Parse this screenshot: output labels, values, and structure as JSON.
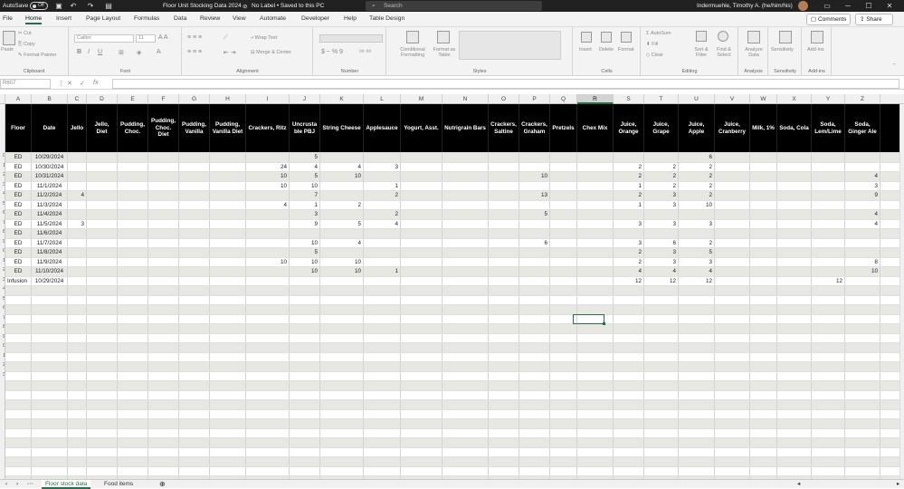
{
  "titlebar": {
    "autosave": "AutoSave",
    "toggle": "Off",
    "filename": "Floor Unit Stocking Data 2024",
    "label_status": "No Label • Saved to this PC",
    "search": "Search",
    "user": "Indermuehle, Timothy A. (he/him/his)",
    "icons": [
      "save-icon",
      "undo-icon",
      "redo-icon",
      "customize-icon"
    ]
  },
  "tabs": [
    "File",
    "Home",
    "Insert",
    "Page Layout",
    "Formulas",
    "Data",
    "Review",
    "View",
    "Automate",
    "Developer",
    "Help",
    "Table Design"
  ],
  "active_tab": "Home",
  "header_buttons": {
    "comments": "Comments",
    "share": "Share"
  },
  "ribbon": {
    "clipboard": {
      "paste": "Paste",
      "cut": "Cut",
      "copy": "Copy",
      "format_painter": "Format Painter",
      "label": "Clipboard"
    },
    "font": {
      "name": "Calibri",
      "size": "11",
      "label": "Font"
    },
    "alignment": {
      "wrap": "Wrap Text",
      "merge": "Merge & Center",
      "label": "Alignment"
    },
    "number": {
      "label": "Number"
    },
    "styles": {
      "conditional": "Conditional Formatting",
      "format_table": "Format as Table",
      "label": "Styles"
    },
    "cells": {
      "insert": "Insert",
      "delete": "Delete",
      "format": "Format",
      "label": "Cells"
    },
    "editing": {
      "autosum": "AutoSum",
      "fill": "Fill",
      "clear": "Clear",
      "sort": "Sort & Filter",
      "find": "Find & Select",
      "label": "Editing"
    },
    "analysis": {
      "analyze": "Analyze Data",
      "label": "Analysis"
    },
    "sensitivity": {
      "btn": "Sensitivity",
      "label": "Sensitivity"
    },
    "addins": {
      "btn": "Add-ins",
      "label": "Add-ins"
    }
  },
  "formula_bar": {
    "name_box": "R607",
    "fx": "fx"
  },
  "columns": [
    "A",
    "B",
    "C",
    "D",
    "E",
    "F",
    "G",
    "H",
    "I",
    "J",
    "K",
    "L",
    "M",
    "N",
    "O",
    "P",
    "Q",
    "R",
    "S",
    "T",
    "U",
    "V",
    "W",
    "X",
    "Y",
    "Z"
  ],
  "selected_column": "R",
  "row_numbers": [
    "0",
    "1",
    "2",
    "3",
    "4",
    "5",
    "6",
    "7",
    "8",
    "9",
    "0",
    "1",
    "2",
    "3",
    "4",
    "5",
    "6",
    "7",
    "8",
    "9",
    "0",
    "1",
    "2",
    "3"
  ],
  "table": {
    "headers": [
      "Floor",
      "Date",
      "Jello",
      "Jello, Diet",
      "Pudding, Choc.",
      "Pudding, Choc. Diet",
      "Pudding, Vanilla",
      "Pudding, Vanilla Diet",
      "Crackers, Ritz",
      "Uncrusta ble PBJ",
      "String Cheese",
      "Applesauce",
      "Yogurt, Asst.",
      "Nutrigrain Bars",
      "Crackers, Saltine",
      "Crackers, Graham",
      "Pretzels",
      "Chex Mix",
      "Juice, Orange",
      "Juice, Grape",
      "Juice, Apple",
      "Juice, Cranberry",
      "Milk, 1%",
      "Soda, Cola",
      "Soda, Lem/Lime",
      "Soda, Ginger Ale"
    ],
    "rows": [
      [
        "ED",
        "10/29/2024",
        "",
        "",
        "",
        "",
        "",
        "",
        "",
        "5",
        "",
        "",
        "",
        "",
        "",
        "",
        "",
        "",
        "",
        "",
        "6",
        "",
        "",
        "",
        "",
        ""
      ],
      [
        "ED",
        "10/30/2024",
        "",
        "",
        "",
        "",
        "",
        "",
        "24",
        "4",
        "4",
        "3",
        "",
        "",
        "",
        "",
        "",
        "",
        "2",
        "2",
        "2",
        "",
        "",
        "",
        "",
        ""
      ],
      [
        "ED",
        "10/31/2024",
        "",
        "",
        "",
        "",
        "",
        "",
        "10",
        "5",
        "10",
        "",
        "",
        "",
        "",
        "10",
        "",
        "",
        "2",
        "2",
        "2",
        "",
        "",
        "",
        "",
        "4"
      ],
      [
        "ED",
        "11/1/2024",
        "",
        "",
        "",
        "",
        "",
        "",
        "10",
        "10",
        "",
        "1",
        "",
        "",
        "",
        "",
        "",
        "",
        "1",
        "2",
        "2",
        "",
        "",
        "",
        "",
        "3"
      ],
      [
        "ED",
        "11/2/2024",
        "4",
        "",
        "",
        "",
        "",
        "",
        "",
        "7",
        "",
        "2",
        "",
        "",
        "",
        "13",
        "",
        "",
        "2",
        "3",
        "2",
        "",
        "",
        "",
        "",
        "9"
      ],
      [
        "ED",
        "11/3/2024",
        "",
        "",
        "",
        "",
        "",
        "",
        "4",
        "1",
        "2",
        "",
        "",
        "",
        "",
        "",
        "",
        "",
        "1",
        "3",
        "10",
        "",
        "",
        "",
        "",
        ""
      ],
      [
        "ED",
        "11/4/2024",
        "",
        "",
        "",
        "",
        "",
        "",
        "",
        "3",
        "",
        "2",
        "",
        "",
        "",
        "5",
        "",
        "",
        "",
        "",
        "",
        "",
        "",
        "",
        "",
        "4"
      ],
      [
        "ED",
        "11/5/2024",
        "3",
        "",
        "",
        "",
        "",
        "",
        "",
        "9",
        "5",
        "4",
        "",
        "",
        "",
        "",
        "",
        "",
        "3",
        "3",
        "3",
        "",
        "",
        "",
        "",
        "4"
      ],
      [
        "ED",
        "11/6/2024",
        "",
        "",
        "",
        "",
        "",
        "",
        "",
        "",
        "",
        "",
        "",
        "",
        "",
        "",
        "",
        "",
        "",
        "",
        "",
        "",
        "",
        "",
        "",
        ""
      ],
      [
        "ED",
        "11/7/2024",
        "",
        "",
        "",
        "",
        "",
        "",
        "",
        "10",
        "4",
        "",
        "",
        "",
        "",
        "6",
        "",
        "",
        "3",
        "6",
        "2",
        "",
        "",
        "",
        "",
        ""
      ],
      [
        "ED",
        "11/8/2024",
        "",
        "",
        "",
        "",
        "",
        "",
        "",
        "5",
        "",
        "",
        "",
        "",
        "",
        "",
        "",
        "",
        "2",
        "3",
        "5",
        "",
        "",
        "",
        "",
        ""
      ],
      [
        "ED",
        "11/9/2024",
        "",
        "",
        "",
        "",
        "",
        "",
        "10",
        "10",
        "10",
        "",
        "",
        "",
        "",
        "",
        "",
        "",
        "2",
        "3",
        "3",
        "",
        "",
        "",
        "",
        "8"
      ],
      [
        "ED",
        "11/10/2024",
        "",
        "",
        "",
        "",
        "",
        "",
        "",
        "10",
        "10",
        "1",
        "",
        "",
        "",
        "",
        "",
        "",
        "4",
        "4",
        "4",
        "",
        "",
        "",
        "",
        "10"
      ],
      [
        "Infusion",
        "10/29/2024",
        "",
        "",
        "",
        "",
        "",
        "",
        "",
        "",
        "",
        "",
        "",
        "",
        "",
        "",
        "",
        "",
        "12",
        "12",
        "12",
        "",
        "",
        "",
        "12",
        ""
      ]
    ]
  },
  "sheets": [
    "Floor stock data",
    "Food items"
  ],
  "active_sheet": "Floor stock data",
  "colors": {
    "accent": "#217346",
    "titlebar": "#212121",
    "header_row": "#000000",
    "band": "#e8e8e3"
  }
}
